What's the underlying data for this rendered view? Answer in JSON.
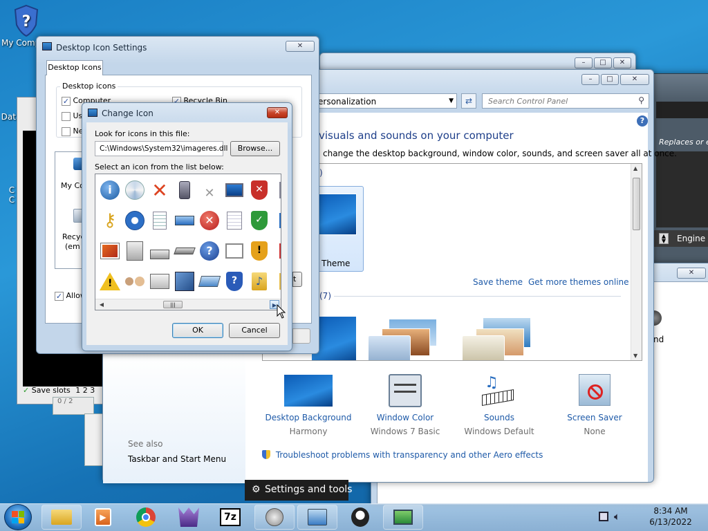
{
  "desktop": {
    "icons": [
      {
        "label": "My Comp"
      },
      {
        "label": "Data"
      },
      {
        "label": "C"
      },
      {
        "label": "C"
      }
    ]
  },
  "desktop_icon_settings": {
    "title": "Desktop Icon Settings",
    "tab": "Desktop Icons",
    "group_label": "Desktop icons",
    "checks": [
      {
        "label": "Computer",
        "checked": true
      },
      {
        "label": "Recycle Bin",
        "checked": true
      },
      {
        "label": "Us",
        "checked": false
      },
      {
        "label": "Ne",
        "checked": false
      }
    ],
    "preview_icons": [
      "My Co",
      "Recyc",
      "(em"
    ],
    "allow_label": "Allow",
    "close_glyph": "✕"
  },
  "change_icon": {
    "title": "Change Icon",
    "look_label": "Look for icons in this file:",
    "file_path": "C:\\Windows\\System32\\imageres.dll",
    "browse": "Browse...",
    "select_label": "Select an icon from the list below:",
    "ok": "OK",
    "cancel": "Cancel",
    "close_glyph": "✕"
  },
  "control_panel": {
    "address": "ersonalization",
    "search_placeholder": "Search Control Panel",
    "heading": "visuals and sounds on your computer",
    "subheading": "change the desktop background, window color, sounds, and screen saver all at once.",
    "themes_header_partial": ")",
    "installed_header_partial": "(7)",
    "theme_label": "Theme",
    "save_theme": "Save theme",
    "get_more": "Get more themes online",
    "bottom_items": [
      {
        "title": "Desktop Background",
        "sub": "Harmony"
      },
      {
        "title": "Window Color",
        "sub": "Windows 7 Basic"
      },
      {
        "title": "Sounds",
        "sub": "Windows Default"
      },
      {
        "title": "Screen Saver",
        "sub": "None"
      }
    ],
    "see_also": "See also",
    "taskbar_link": "Taskbar and Start Menu",
    "troubleshoot": "Troubleshoot problems with transparency and other Aero effects"
  },
  "right_panel": {
    "replaces_text": "Replaces or edi",
    "engine_text": "Engine P",
    "nd_text": "nd"
  },
  "left_app": {
    "save_slots": "Save slots",
    "slots": [
      "1",
      "2",
      "3"
    ],
    "frac": "0 / 2"
  },
  "settings_tools": "Settings and tools",
  "taskbar": {
    "time": "8:34 AM",
    "date": "6/13/2022"
  }
}
